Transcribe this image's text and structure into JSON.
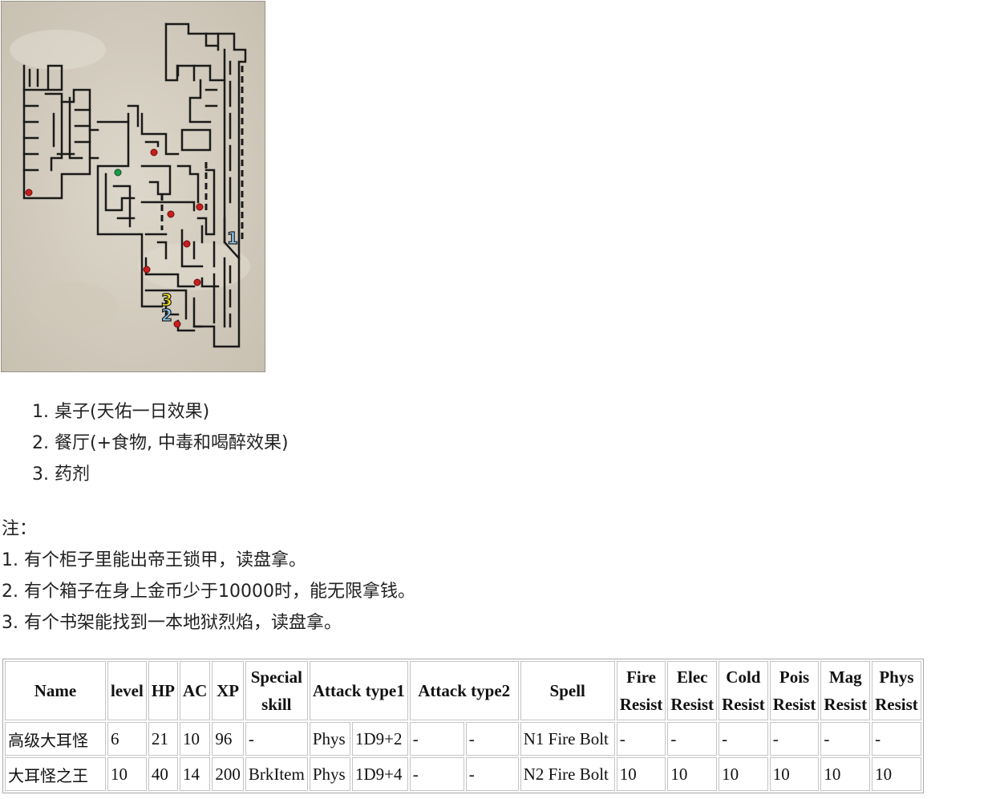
{
  "map": {
    "markers": [
      {
        "label": "1",
        "color": "#8ec9ee"
      },
      {
        "label": "2",
        "color": "#8ec9ee"
      },
      {
        "label": "3",
        "color": "#f4e521"
      }
    ],
    "dot_colors": {
      "enemy": "#c81e1e",
      "player": "#1e9a4a"
    }
  },
  "legend": {
    "items": [
      "1. 桌子(天佑一日效果)",
      "2. 餐厅(+食物, 中毒和喝醉效果)",
      "3. 药剂"
    ]
  },
  "notes": {
    "heading": "注：",
    "lines": [
      "1. 有个柜子里能出帝王锁甲，读盘拿。",
      "2. 有个箱子在身上金币少于10000时，能无限拿钱。",
      "3. 有个书架能找到一本地狱烈焰，读盘拿。"
    ]
  },
  "table": {
    "headers": {
      "name": "Name",
      "level": "level",
      "hp": "HP",
      "ac": "AC",
      "xp": "XP",
      "special_1": "Special",
      "special_2": "skill",
      "attack1": "Attack type1",
      "attack2": "Attack type2",
      "spell": "Spell",
      "fire_1": "Fire",
      "fire_2": "Resist",
      "elec_1": "Elec",
      "elec_2": "Resist",
      "cold_1": "Cold",
      "cold_2": "Resist",
      "pois_1": "Pois",
      "pois_2": "Resist",
      "mag_1": "Mag",
      "mag_2": "Resist",
      "phys_1": "Phys",
      "phys_2": "Resist"
    },
    "rows": [
      {
        "name": "高级大耳怪",
        "level": "6",
        "hp": "21",
        "ac": "10",
        "xp": "96",
        "special": "-",
        "atk1_type": "Phys",
        "atk1_dmg": "1D9+2",
        "atk2_type": "-",
        "atk2_dmg": "-",
        "spell": "N1 Fire Bolt",
        "fire": "-",
        "elec": "-",
        "cold": "-",
        "pois": "-",
        "mag": "-",
        "phys": "-"
      },
      {
        "name": "大耳怪之王",
        "level": "10",
        "hp": "40",
        "ac": "14",
        "xp": "200",
        "special": "BrkItem",
        "atk1_type": "Phys",
        "atk1_dmg": "1D9+4",
        "atk2_type": "-",
        "atk2_dmg": "-",
        "spell": "N2 Fire Bolt",
        "fire": "10",
        "elec": "10",
        "cold": "10",
        "pois": "10",
        "mag": "10",
        "phys": "10"
      }
    ]
  }
}
